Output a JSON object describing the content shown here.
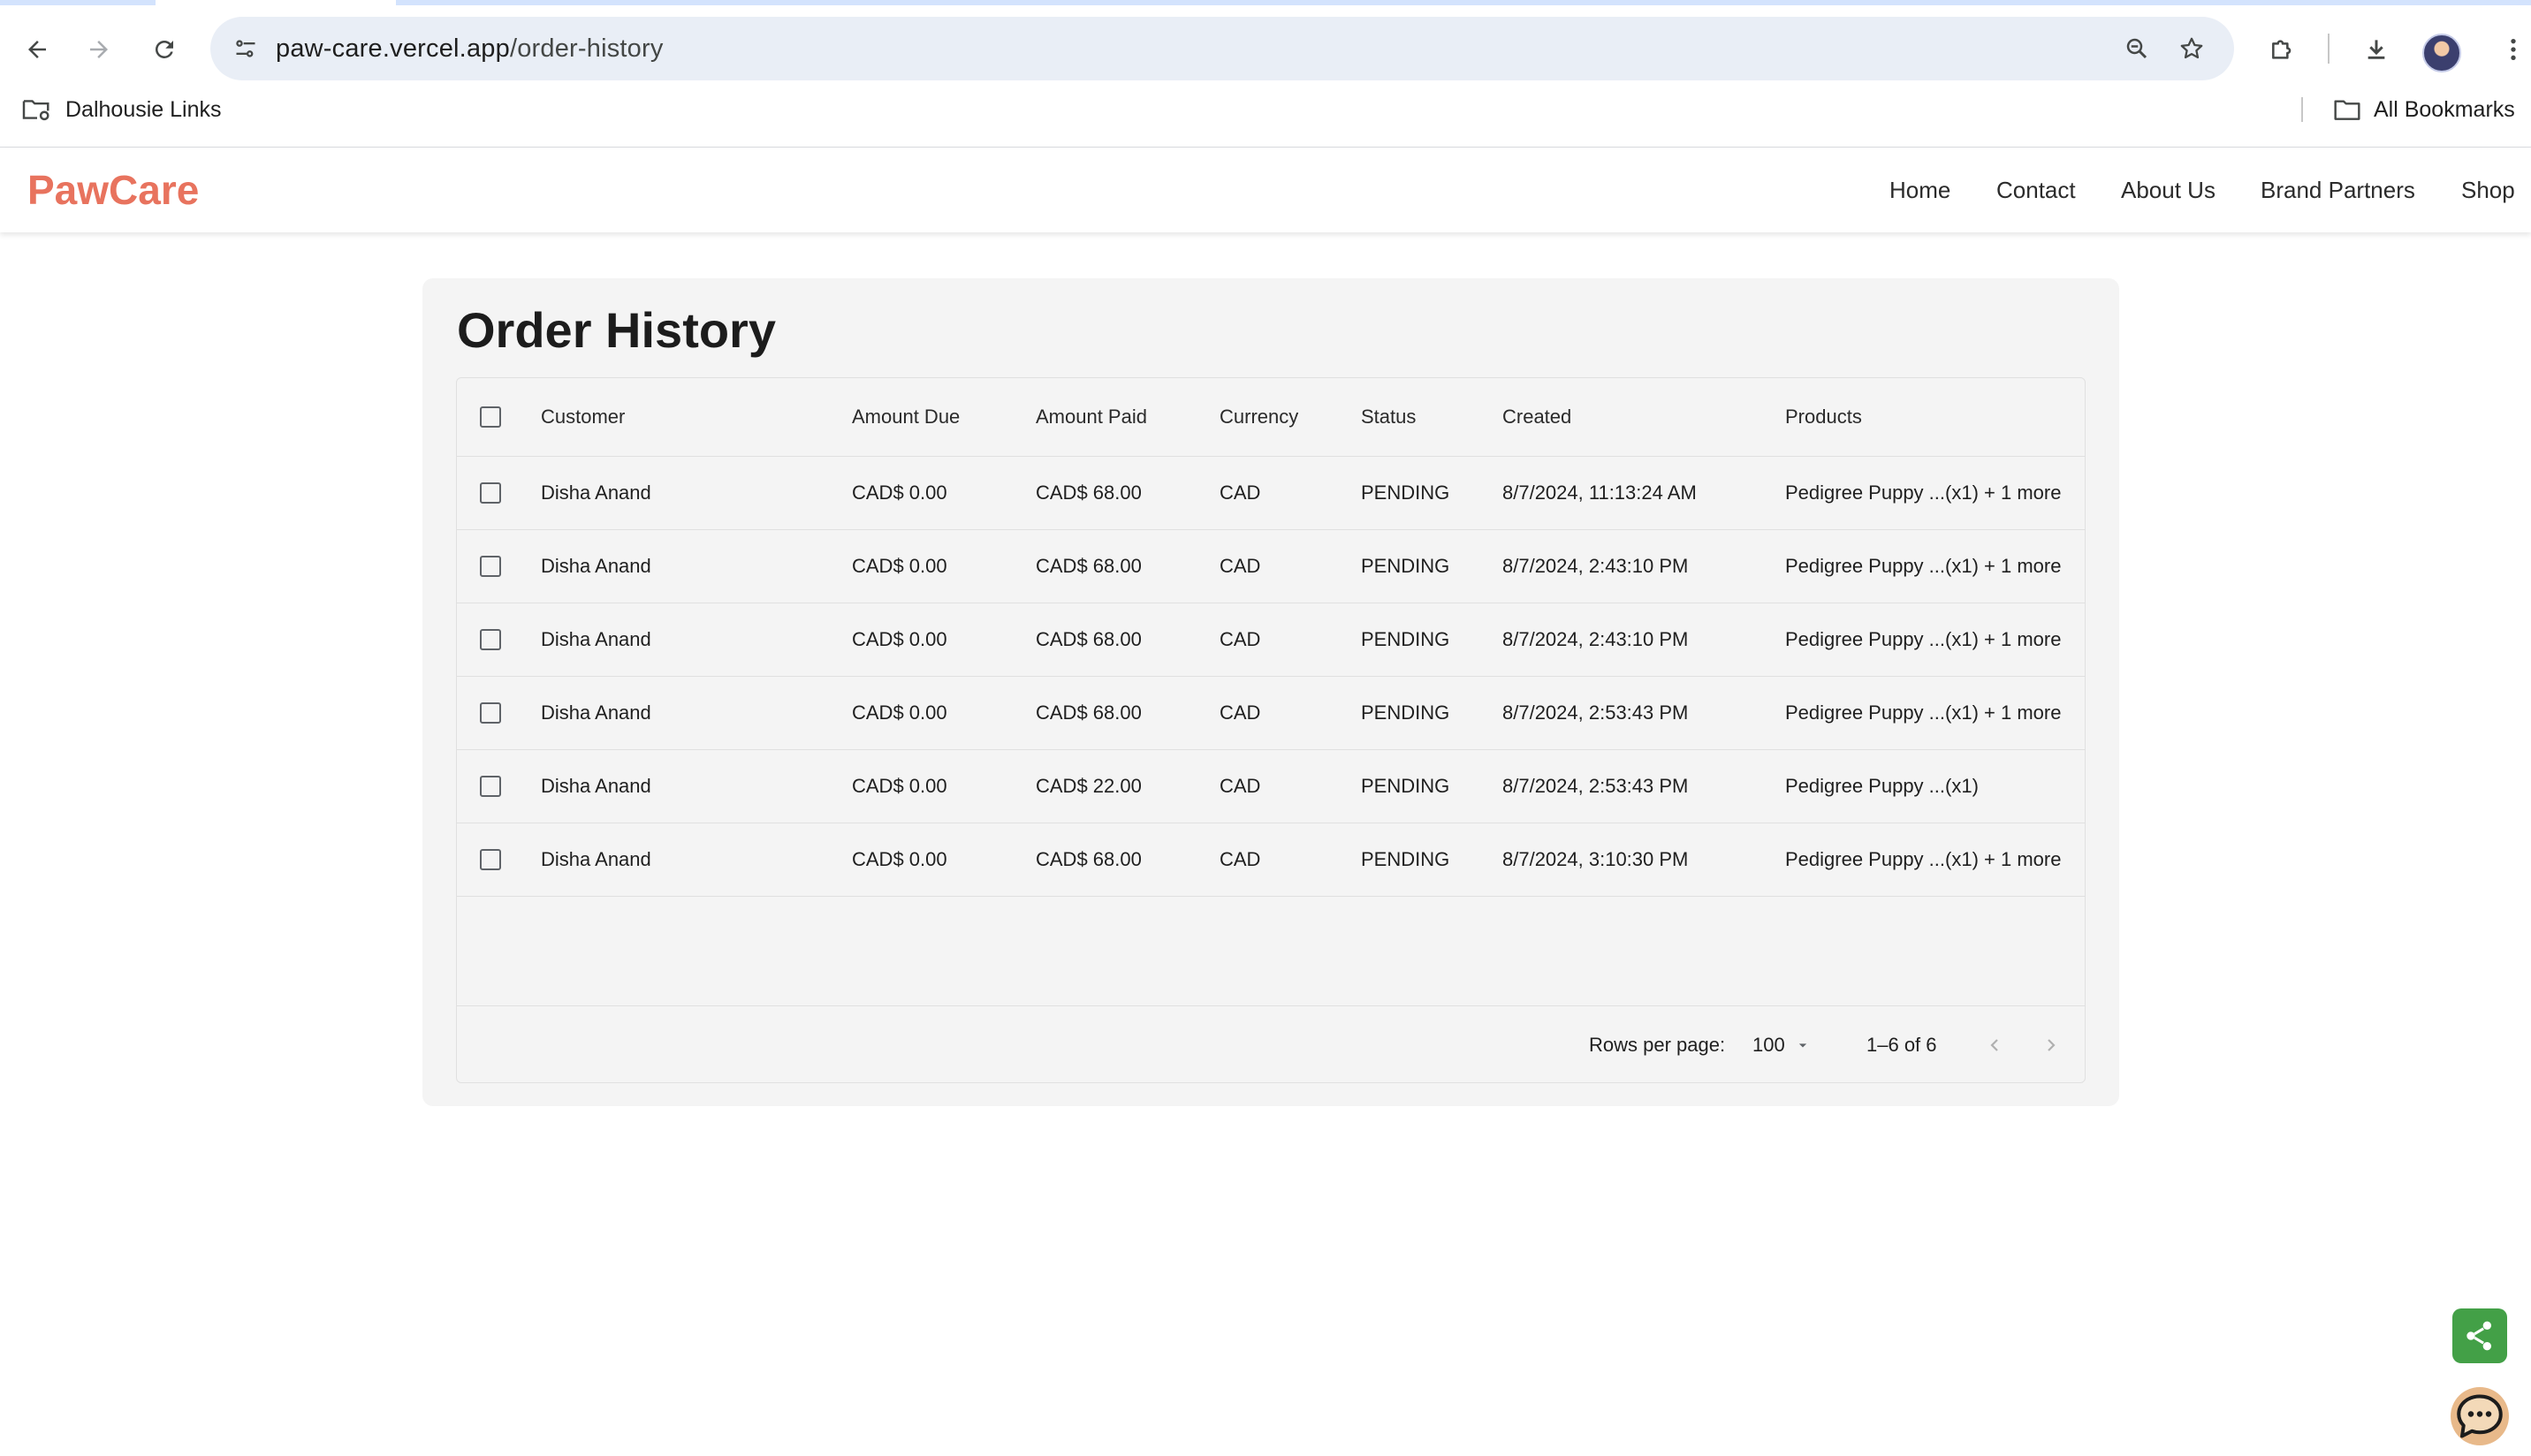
{
  "browser": {
    "url_host": "paw-care.vercel.app",
    "url_path": "/order-history",
    "bookmarks": [
      {
        "label": "Dalhousie Links"
      }
    ],
    "all_bookmarks_label": "All Bookmarks"
  },
  "site": {
    "logo": "PawCare",
    "nav": [
      "Home",
      "Contact",
      "About Us",
      "Brand Partners",
      "Shop"
    ],
    "brand_color": "#e8735e"
  },
  "page": {
    "title": "Order History"
  },
  "table": {
    "columns": [
      "Customer",
      "Amount Due",
      "Amount Paid",
      "Currency",
      "Status",
      "Created",
      "Products"
    ],
    "rows": [
      [
        "Disha Anand",
        "CAD$ 0.00",
        "CAD$ 68.00",
        "CAD",
        "PENDING",
        "8/7/2024, 11:13:24 AM",
        "Pedigree Puppy ...(x1) + 1 more"
      ],
      [
        "Disha Anand",
        "CAD$ 0.00",
        "CAD$ 68.00",
        "CAD",
        "PENDING",
        "8/7/2024, 2:43:10 PM",
        "Pedigree Puppy ...(x1) + 1 more"
      ],
      [
        "Disha Anand",
        "CAD$ 0.00",
        "CAD$ 68.00",
        "CAD",
        "PENDING",
        "8/7/2024, 2:43:10 PM",
        "Pedigree Puppy ...(x1) + 1 more"
      ],
      [
        "Disha Anand",
        "CAD$ 0.00",
        "CAD$ 68.00",
        "CAD",
        "PENDING",
        "8/7/2024, 2:53:43 PM",
        "Pedigree Puppy ...(x1) + 1 more"
      ],
      [
        "Disha Anand",
        "CAD$ 0.00",
        "CAD$ 22.00",
        "CAD",
        "PENDING",
        "8/7/2024, 2:53:43 PM",
        "Pedigree Puppy ...(x1)"
      ],
      [
        "Disha Anand",
        "CAD$ 0.00",
        "CAD$ 68.00",
        "CAD",
        "PENDING",
        "8/7/2024, 3:10:30 PM",
        "Pedigree Puppy ...(x1) + 1 more"
      ]
    ],
    "pagination": {
      "rows_per_page_label": "Rows per page:",
      "rows_per_page_value": "100",
      "range": "1–6 of 6"
    }
  },
  "floating": {
    "share_color": "#43a047",
    "chat_color": "#e8b98a"
  }
}
